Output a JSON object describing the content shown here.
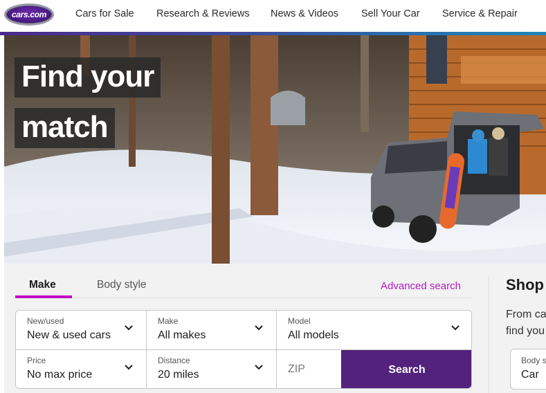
{
  "header": {
    "logo_text": "cars.com",
    "nav": [
      {
        "label": "Cars for Sale"
      },
      {
        "label": "Research & Reviews"
      },
      {
        "label": "News & Videos"
      },
      {
        "label": "Sell Your Car"
      },
      {
        "label": "Service & Repair"
      }
    ]
  },
  "hero": {
    "title_lines": [
      "Find your",
      "match"
    ]
  },
  "search": {
    "tabs": [
      {
        "label": "Make",
        "active": true
      },
      {
        "label": "Body style",
        "active": false
      }
    ],
    "advanced_link": "Advanced search",
    "fields": {
      "new_used": {
        "label": "New/used",
        "value": "New & used cars"
      },
      "make": {
        "label": "Make",
        "value": "All makes"
      },
      "model": {
        "label": "Model",
        "value": "All models"
      },
      "price": {
        "label": "Price",
        "value": "No max price"
      },
      "distance": {
        "label": "Distance",
        "value": "20 miles"
      },
      "zip": {
        "placeholder": "ZIP",
        "value": ""
      }
    },
    "search_button": "Search"
  },
  "shop": {
    "title": "Shop",
    "description_lines": [
      "From ca",
      "find you"
    ],
    "body_style": {
      "label": "Body st",
      "value": "Car"
    }
  },
  "colors": {
    "accent_magenta": "#c20ac4",
    "link_magenta": "#b41bc2",
    "brand_purple": "#52227c"
  }
}
